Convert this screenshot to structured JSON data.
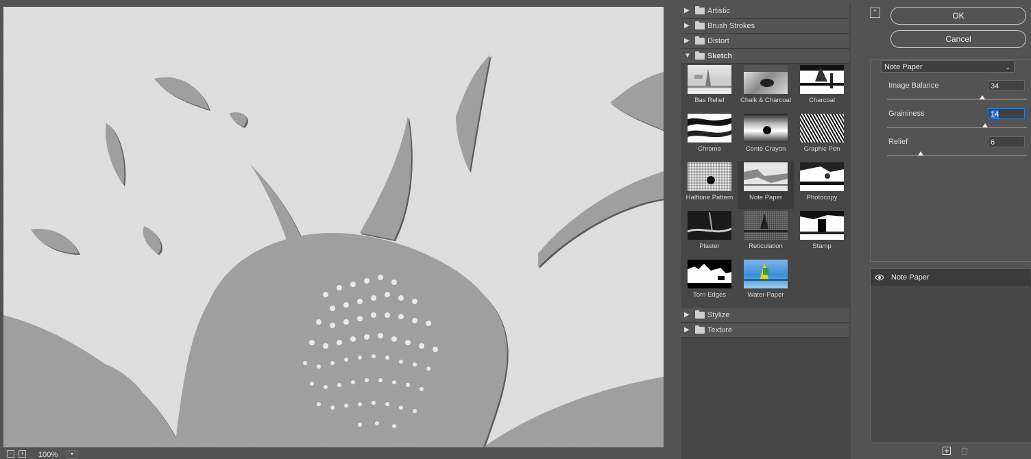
{
  "preview": {
    "zoom": "100%",
    "zoom_out": "−",
    "zoom_in": "+",
    "zoom_menu": "▾"
  },
  "gallery": {
    "categories_top": [
      {
        "label": "Artistic",
        "arrow": "▶"
      },
      {
        "label": "Brush Strokes",
        "arrow": "▶"
      },
      {
        "label": "Distort",
        "arrow": "▶"
      },
      {
        "label": "Sketch",
        "arrow": "▼"
      }
    ],
    "categories_bottom": [
      {
        "label": "Stylize",
        "arrow": "▶"
      },
      {
        "label": "Texture",
        "arrow": "▶"
      }
    ],
    "sketch_filters": [
      {
        "label": "Bas Relief"
      },
      {
        "label": "Chalk & Charcoal"
      },
      {
        "label": "Charcoal"
      },
      {
        "label": "Chrome"
      },
      {
        "label": "Conté Crayon"
      },
      {
        "label": "Graphic Pen"
      },
      {
        "label": "Halftone Pattern"
      },
      {
        "label": "Note Paper"
      },
      {
        "label": "Photocopy"
      },
      {
        "label": "Plaster"
      },
      {
        "label": "Reticulation"
      },
      {
        "label": "Stamp"
      },
      {
        "label": "Torn Edges"
      },
      {
        "label": "Water Paper"
      }
    ],
    "selected": "Note Paper"
  },
  "panel": {
    "collapse_icon": "⌃",
    "ok_label": "OK",
    "cancel_label": "Cancel",
    "filter_select": "Note Paper",
    "select_chevron": "⌄",
    "params": [
      {
        "label": "Image Balance",
        "value": "34",
        "fraction": 0.68
      },
      {
        "label": "Graininess",
        "value": "14",
        "fraction": 0.7
      },
      {
        "label": "Relief",
        "value": "6",
        "fraction": 0.24
      }
    ],
    "layer_name": "Note Paper"
  },
  "colors": {
    "accent": "#2a6ccf",
    "background": "#535353",
    "gallery_bg": "#474747"
  }
}
